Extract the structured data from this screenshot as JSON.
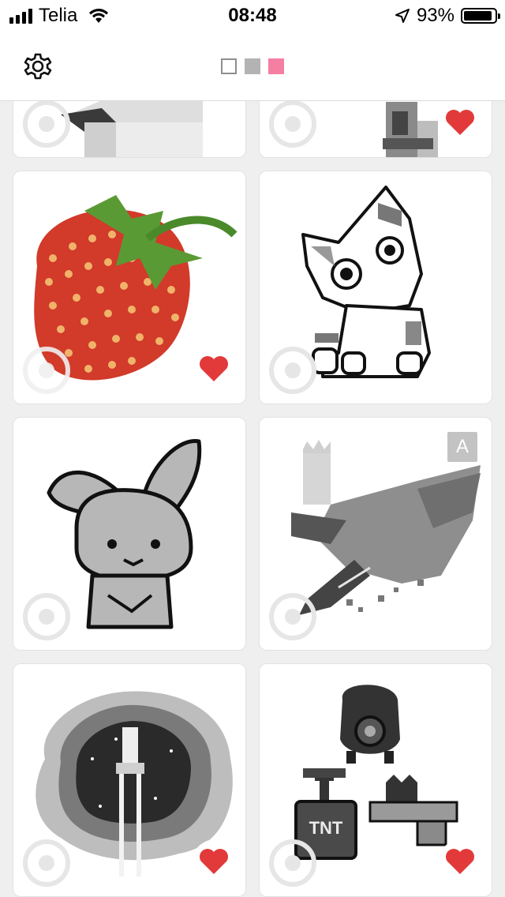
{
  "status_bar": {
    "carrier": "Telia",
    "time": "08:48",
    "battery": "93%"
  },
  "nav": {
    "palette": [
      "white",
      "gray",
      "pink"
    ]
  },
  "accent": "#e23a3a",
  "cards": [
    {
      "subject": "cube",
      "favorited": false
    },
    {
      "subject": "robot-legs",
      "favorited": true
    },
    {
      "subject": "strawberry",
      "favorited": true
    },
    {
      "subject": "cat",
      "favorited": false
    },
    {
      "subject": "bunny",
      "favorited": false
    },
    {
      "subject": "running-king",
      "favorited": false,
      "badge": "A"
    },
    {
      "subject": "space-rocket",
      "favorited": true
    },
    {
      "subject": "tnt-robot-gun",
      "favorited": true
    }
  ]
}
